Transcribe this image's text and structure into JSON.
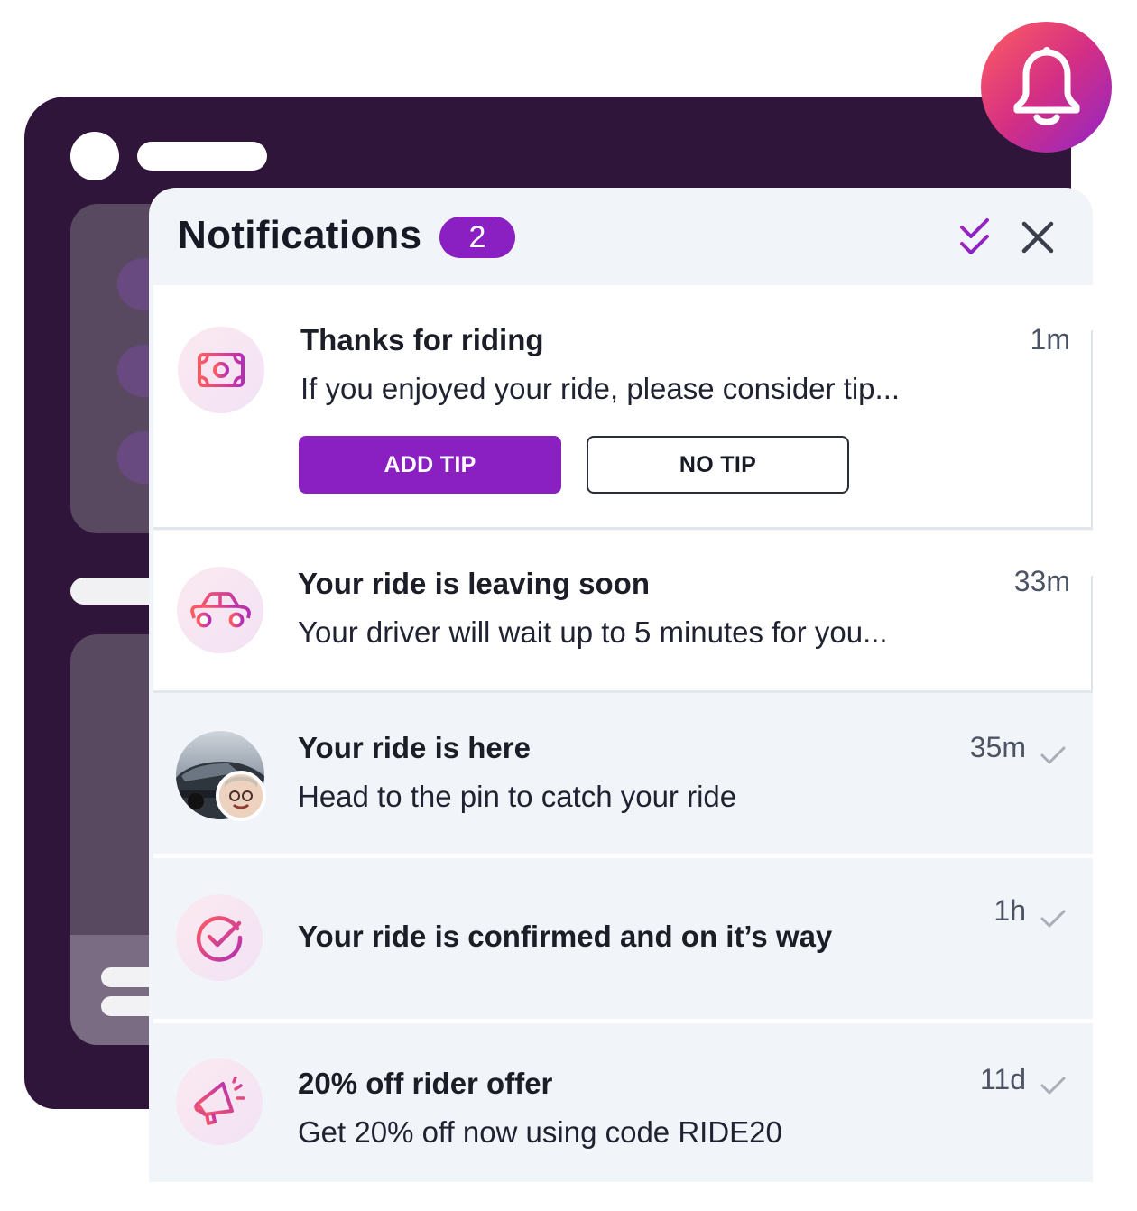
{
  "header": {
    "title": "Notifications",
    "count": "2"
  },
  "notifications": [
    {
      "icon": "money-icon",
      "title": "Thanks for riding",
      "body": "If you enjoyed your ride, please consider tip...",
      "time": "1m",
      "unread": true,
      "actions": {
        "primary_label": "ADD TIP",
        "secondary_label": "NO TIP"
      }
    },
    {
      "icon": "car-icon",
      "title": "Your ride is leaving soon",
      "body": "Your driver will wait up to 5 minutes for you...",
      "time": "33m",
      "unread": true
    },
    {
      "icon": "driver-avatar",
      "title": "Your ride is here",
      "body": "Head to the pin to catch your ride",
      "time": "35m",
      "unread": false
    },
    {
      "icon": "check-circle-icon",
      "title": "Your ride is confirmed and on it’s way",
      "body": "",
      "time": "1h",
      "unread": false
    },
    {
      "icon": "megaphone-icon",
      "title": "20% off rider offer",
      "body": "Get 20% off now using code RIDE20",
      "time": "11d",
      "unread": false
    }
  ],
  "colors": {
    "accent": "#8a1fc2",
    "background_window": "#2e1539",
    "panel": "#f1f4f8",
    "bell_gradient_start": "#ff5f61",
    "bell_gradient_end": "#8f25c7"
  }
}
